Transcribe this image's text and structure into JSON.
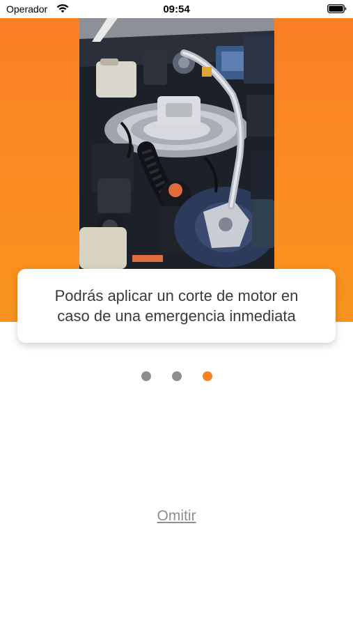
{
  "status_bar": {
    "carrier": "Operador",
    "time": "09:54",
    "wifi_icon": "wifi-icon",
    "battery_icon": "battery-full-icon"
  },
  "onboarding": {
    "image_description": "car-engine-bay-photo",
    "message": "Podrás aplicar un corte de motor en\ncaso de una emergencia inmediata",
    "page_count": 3,
    "current_page": 3,
    "skip_label": "Omitir"
  },
  "colors": {
    "accent": "#fb7f25",
    "inactive_dot": "#8e8e8e",
    "text": "#3a3a3a"
  }
}
